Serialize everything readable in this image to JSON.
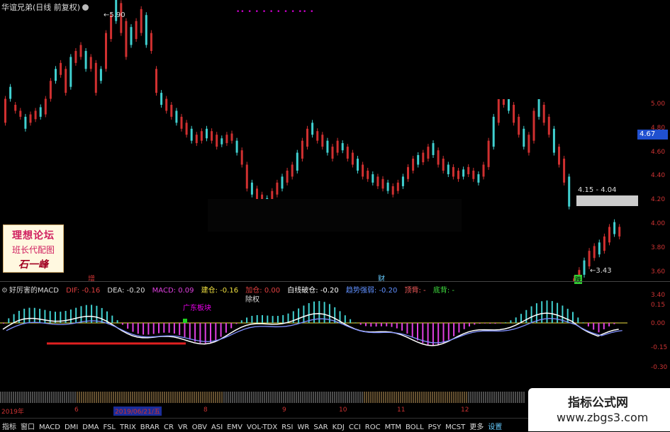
{
  "window": {
    "title": "华谊兄弟(日线 前复权)"
  },
  "main_chart": {
    "y_ticks": [
      "5.00",
      "4.80",
      "4.60",
      "4.40",
      "4.20",
      "4.00",
      "3.80",
      "3.60",
      "3.40"
    ],
    "current_price": "4.67",
    "high_label": "5.90",
    "range_label": "4.15 - 4.04",
    "low_label": "3.43",
    "purple_marks": "•• • • • •  •  •  •  •• •",
    "marker_zeng": "增",
    "marker_cai": "财",
    "marker_die": "跌",
    "stamp": {
      "line1": "理想论坛",
      "line2": "班长代配图",
      "line3": "石一峰"
    },
    "colors": {
      "up": "#d03030",
      "down": "#40d0d0",
      "badge": "#2050d0"
    },
    "candles": [
      [
        0,
        4.85,
        5.05
      ],
      [
        1,
        5.05,
        5.15
      ],
      [
        2,
        4.95,
        5.0
      ],
      [
        3,
        4.9,
        4.95
      ],
      [
        4,
        4.8,
        4.9
      ],
      [
        5,
        4.85,
        4.92
      ],
      [
        6,
        4.88,
        4.95
      ],
      [
        7,
        4.9,
        4.98
      ],
      [
        8,
        4.92,
        5.05
      ],
      [
        9,
        5.05,
        5.2
      ],
      [
        10,
        5.2,
        5.3
      ],
      [
        11,
        5.25,
        5.35
      ],
      [
        12,
        5.1,
        5.3
      ],
      [
        13,
        5.15,
        5.4
      ],
      [
        14,
        5.35,
        5.45
      ],
      [
        15,
        5.4,
        5.5
      ],
      [
        16,
        5.3,
        5.45
      ],
      [
        17,
        5.3,
        5.4
      ],
      [
        18,
        5.1,
        5.35
      ],
      [
        19,
        5.2,
        5.3
      ],
      [
        20,
        5.3,
        5.6
      ],
      [
        21,
        5.55,
        5.75
      ],
      [
        22,
        5.7,
        5.9
      ],
      [
        23,
        5.6,
        5.85
      ],
      [
        24,
        5.4,
        5.7
      ],
      [
        25,
        5.5,
        5.65
      ],
      [
        26,
        5.55,
        5.7
      ],
      [
        27,
        5.6,
        5.8
      ],
      [
        28,
        5.5,
        5.75
      ],
      [
        29,
        5.45,
        5.6
      ],
      [
        30,
        5.1,
        5.3
      ],
      [
        31,
        5.0,
        5.1
      ],
      [
        32,
        4.95,
        5.05
      ],
      [
        33,
        4.9,
        5.0
      ],
      [
        34,
        4.85,
        4.95
      ],
      [
        35,
        4.8,
        4.9
      ],
      [
        36,
        4.75,
        4.85
      ],
      [
        37,
        4.7,
        4.8
      ],
      [
        38,
        4.68,
        4.75
      ],
      [
        39,
        4.7,
        4.78
      ],
      [
        40,
        4.72,
        4.8
      ],
      [
        41,
        4.7,
        4.78
      ],
      [
        42,
        4.65,
        4.75
      ],
      [
        43,
        4.67,
        4.72
      ],
      [
        44,
        4.68,
        4.75
      ],
      [
        45,
        4.7,
        4.76
      ],
      [
        46,
        4.6,
        4.7
      ],
      [
        47,
        4.5,
        4.62
      ],
      [
        48,
        4.3,
        4.5
      ],
      [
        49,
        4.25,
        4.35
      ],
      [
        50,
        4.2,
        4.3
      ],
      [
        51,
        4.18,
        4.25
      ],
      [
        52,
        4.15,
        4.22
      ],
      [
        53,
        4.18,
        4.28
      ],
      [
        54,
        4.25,
        4.35
      ],
      [
        55,
        4.3,
        4.4
      ],
      [
        56,
        4.35,
        4.45
      ],
      [
        57,
        4.4,
        4.5
      ],
      [
        58,
        4.45,
        4.6
      ],
      [
        59,
        4.55,
        4.7
      ],
      [
        60,
        4.65,
        4.8
      ],
      [
        61,
        4.75,
        4.85
      ],
      [
        62,
        4.7,
        4.78
      ],
      [
        63,
        4.65,
        4.75
      ],
      [
        64,
        4.6,
        4.7
      ],
      [
        65,
        4.55,
        4.65
      ],
      [
        66,
        4.6,
        4.7
      ],
      [
        67,
        4.62,
        4.68
      ],
      [
        68,
        4.55,
        4.65
      ],
      [
        69,
        4.5,
        4.6
      ],
      [
        70,
        4.45,
        4.55
      ],
      [
        71,
        4.4,
        4.5
      ],
      [
        72,
        4.38,
        4.45
      ],
      [
        73,
        4.35,
        4.42
      ],
      [
        74,
        4.32,
        4.4
      ],
      [
        75,
        4.3,
        4.38
      ],
      [
        76,
        4.28,
        4.35
      ],
      [
        77,
        4.25,
        4.32
      ],
      [
        78,
        4.28,
        4.35
      ],
      [
        79,
        4.32,
        4.4
      ],
      [
        80,
        4.38,
        4.48
      ],
      [
        81,
        4.45,
        4.55
      ],
      [
        82,
        4.5,
        4.58
      ],
      [
        83,
        4.52,
        4.6
      ],
      [
        84,
        4.55,
        4.65
      ],
      [
        85,
        4.58,
        4.68
      ],
      [
        86,
        4.5,
        4.62
      ],
      [
        87,
        4.45,
        4.55
      ],
      [
        88,
        4.42,
        4.5
      ],
      [
        89,
        4.4,
        4.48
      ],
      [
        90,
        4.38,
        4.45
      ],
      [
        91,
        4.4,
        4.46
      ],
      [
        92,
        4.42,
        4.48
      ],
      [
        93,
        4.38,
        4.45
      ],
      [
        94,
        4.35,
        4.42
      ],
      [
        95,
        4.4,
        4.5
      ],
      [
        96,
        4.48,
        4.7
      ],
      [
        97,
        4.65,
        4.9
      ],
      [
        98,
        4.85,
        5.1
      ],
      [
        99,
        5.0,
        5.2
      ],
      [
        100,
        4.95,
        5.1
      ],
      [
        101,
        4.85,
        5.0
      ],
      [
        102,
        4.75,
        4.9
      ],
      [
        103,
        4.65,
        4.8
      ],
      [
        104,
        4.6,
        4.75
      ],
      [
        105,
        4.7,
        4.95
      ],
      [
        106,
        4.9,
        5.1
      ],
      [
        107,
        4.85,
        5.0
      ],
      [
        108,
        4.75,
        4.9
      ],
      [
        109,
        4.6,
        4.8
      ],
      [
        110,
        4.5,
        4.65
      ],
      [
        111,
        4.35,
        4.55
      ],
      [
        112,
        4.15,
        4.4
      ],
      [
        113,
        3.45,
        3.55
      ],
      [
        114,
        3.5,
        3.62
      ],
      [
        115,
        3.58,
        3.7
      ],
      [
        116,
        3.65,
        3.78
      ],
      [
        117,
        3.72,
        3.82
      ],
      [
        118,
        3.75,
        3.85
      ],
      [
        119,
        3.78,
        3.9
      ],
      [
        120,
        3.85,
        3.98
      ],
      [
        121,
        3.92,
        4.02
      ],
      [
        122,
        3.9,
        3.98
      ]
    ]
  },
  "macd": {
    "indicator_name": "好厉害的MACD",
    "dif_label": "DIF: -0.16",
    "dea_label": "DEA: -0.20",
    "macd_label": "MACD: 0.09",
    "jiancang_label": "建仓: -0.16",
    "jiacang_label": "加仓: 0.00",
    "baixian_label": "白线破仓: -0.20",
    "trend_label": "趋势强弱: -0.20",
    "dingbei_label": "顶背: -",
    "dibei_label": "底背: -",
    "annotation_guangdong": "广东板块",
    "annotation_cq": "除权",
    "y_ticks": [
      "0.15",
      "0.00",
      "-0.15",
      "-0.30"
    ]
  },
  "time_axis": {
    "labels": [
      "2019年",
      "6",
      "2019/06/21/五",
      "8",
      "9",
      "10",
      "11",
      "12"
    ]
  },
  "toolbar": {
    "items": [
      "指标",
      "窗口",
      "MACD",
      "DMI",
      "DMA",
      "FSL",
      "TRIX",
      "BRAR",
      "CR",
      "VR",
      "OBV",
      "ASI",
      "EMV",
      "VOL-TDX",
      "RSI",
      "WR",
      "SAR",
      "KDJ",
      "CCI",
      "ROC",
      "MTM",
      "BOLL",
      "PSY",
      "MCST",
      "更多",
      "设置"
    ]
  },
  "watermark": {
    "title": "指标公式网",
    "url": "www.zbgs3.com"
  }
}
